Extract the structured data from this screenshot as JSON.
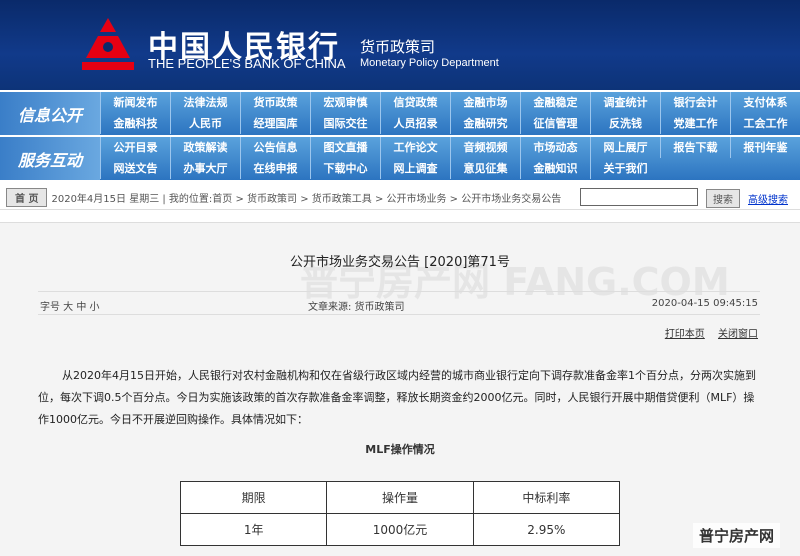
{
  "header": {
    "bank_cn": "中国人民银行",
    "bank_en": "THE PEOPLE'S BANK OF CHINA",
    "department_cn": "货币政策司",
    "department_en": "Monetary Policy Department"
  },
  "nav": [
    {
      "label": "信息公开",
      "items": [
        "新闻发布",
        "法律法规",
        "货币政策",
        "宏观审慎",
        "信贷政策",
        "金融市场",
        "金融稳定",
        "调查统计",
        "银行会计",
        "支付体系",
        "金融科技",
        "人民币",
        "经理国库",
        "国际交往",
        "人员招录",
        "金融研究",
        "征信管理",
        "反洗钱",
        "党建工作",
        "工会工作"
      ]
    },
    {
      "label": "服务互动",
      "items": [
        "公开目录",
        "政策解读",
        "公告信息",
        "图文直播",
        "工作论文",
        "音频视频",
        "市场动态",
        "网上展厅",
        "报告下载",
        "报刊年鉴",
        "网送文告",
        "办事大厅",
        "在线申报",
        "下载中心",
        "网上调查",
        "意见征集",
        "金融知识",
        "关于我们"
      ]
    }
  ],
  "breadcrumb": {
    "home": "首 页",
    "text": "2020年4月15日 星期三 | 我的位置:首页 > 货币政策司 > 货币政策工具 > 公开市场业务 > 公开市场业务交易公告",
    "search_button": "搜索",
    "advanced": "高级搜索",
    "search_value": ""
  },
  "article": {
    "title": "公开市场业务交易公告 [2020]第71号",
    "font_label": "字号 大 中 小",
    "source": "文章来源: 货币政策司",
    "datetime": "2020-04-15 09:45:15",
    "print": "打印本页",
    "close": "关闭窗口",
    "body": "从2020年4月15日开始，人民银行对农村金融机构和仅在省级行政区域内经营的城市商业银行定向下调存款准备金率1个百分点，分两次实施到位，每次下调0.5个百分点。今日为实施该政策的首次存款准备金率调整，释放长期资金约2000亿元。同时，人民银行开展中期借贷便利（MLF）操作1000亿元。今日不开展逆回购操作。具体情况如下：",
    "table_title": "MLF操作情况",
    "table": {
      "headers": [
        "期限",
        "操作量",
        "中标利率"
      ],
      "rows": [
        [
          "1年",
          "1000亿元",
          "2.95%"
        ]
      ]
    }
  },
  "watermark": {
    "corner": "普宁房产网",
    "center": "普宁房产网 FANG.COM"
  }
}
